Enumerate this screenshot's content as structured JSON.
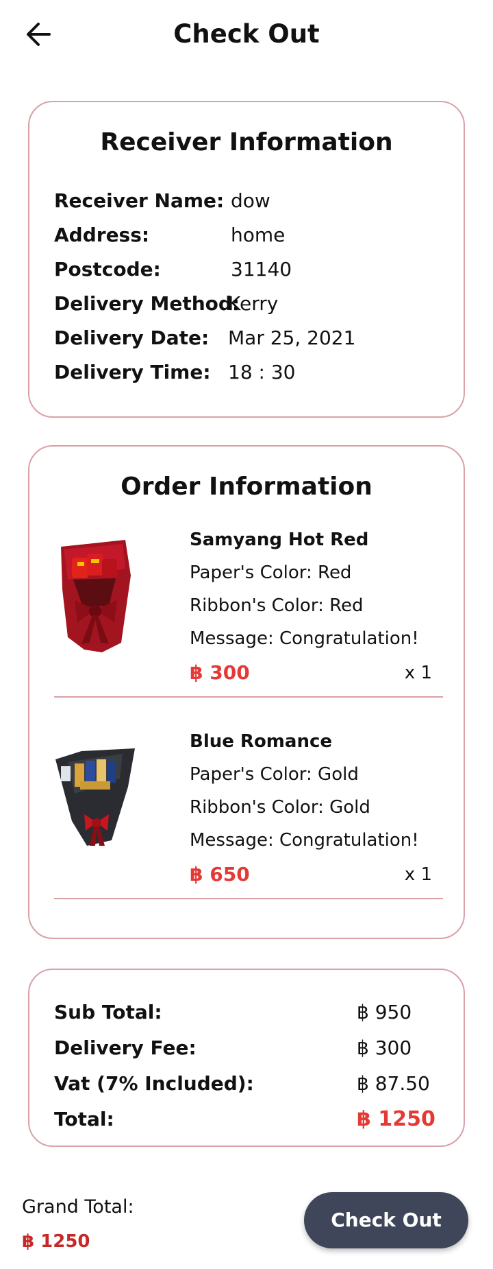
{
  "header": {
    "title": "Check Out",
    "back_icon": "arrow-left-icon"
  },
  "receiver": {
    "title": "Receiver Information",
    "fields": [
      {
        "label": "Receiver Name:",
        "value": "dow"
      },
      {
        "label": "Address:",
        "value": "home"
      },
      {
        "label": "Postcode:",
        "value": "31140"
      },
      {
        "label": "Delivery Method:",
        "value": "Kerry"
      },
      {
        "label": "Delivery Date:",
        "value": "Mar 25, 2021"
      },
      {
        "label": "Delivery Time:",
        "value": "18 : 30"
      }
    ]
  },
  "order": {
    "title": "Order Information",
    "items": [
      {
        "name": "Samyang Hot Red",
        "paper": "Paper's Color: Red",
        "ribbon": "Ribbon's Color: Red",
        "message": "Message: Congratulation!",
        "price": "฿ 300",
        "qty": "x 1",
        "image": "red-bouquet-image"
      },
      {
        "name": "Blue Romance",
        "paper": "Paper's Color: Gold",
        "ribbon": "Ribbon's Color: Gold",
        "message": "Message: Congratulation!",
        "price": "฿ 650",
        "qty": "x 1",
        "image": "black-bouquet-image"
      }
    ]
  },
  "summary": {
    "rows": [
      {
        "label": "Sub Total:",
        "value": "฿ 950"
      },
      {
        "label": "Delivery Fee:",
        "value": "฿ 300"
      },
      {
        "label": "Vat (7% Included):",
        "value": "฿ 87.50"
      },
      {
        "label": "Total:",
        "value": "฿ 1250"
      }
    ]
  },
  "footer": {
    "grand_label": "Grand Total:",
    "grand_value": "฿ 1250",
    "checkout_label": "Check Out"
  },
  "colors": {
    "accent_red": "#e53935",
    "border_pink": "#d9a0a6",
    "button_dark": "#3f4659"
  }
}
